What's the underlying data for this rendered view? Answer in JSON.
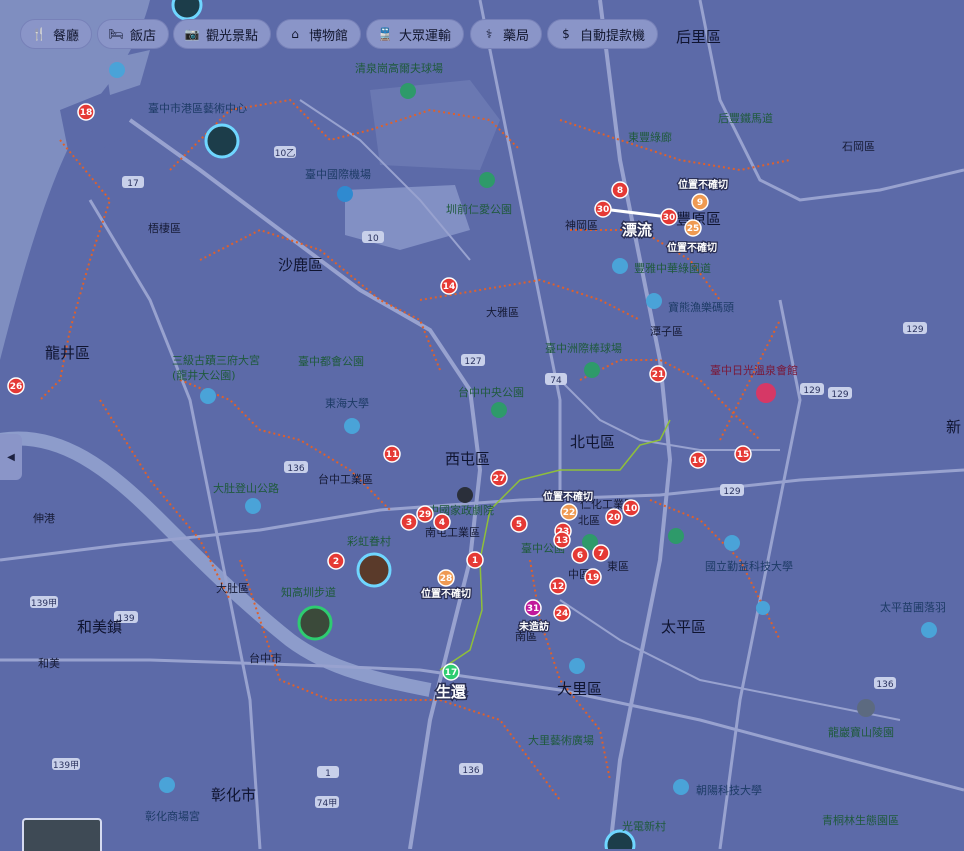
{
  "filters": [
    {
      "label": "餐廳",
      "icon": "restaurant-icon",
      "glyph": "🍴"
    },
    {
      "label": "飯店",
      "icon": "hotel-icon",
      "glyph": "🛏"
    },
    {
      "label": "觀光景點",
      "icon": "camera-icon",
      "glyph": "📷"
    },
    {
      "label": "博物館",
      "icon": "museum-icon",
      "glyph": "⌂"
    },
    {
      "label": "大眾運輸",
      "icon": "transit-icon",
      "glyph": "🚆"
    },
    {
      "label": "藥局",
      "icon": "pharmacy-icon",
      "glyph": "⚕"
    },
    {
      "label": "自動提款機",
      "icon": "atm-icon",
      "glyph": "$"
    }
  ],
  "districts": [
    {
      "name": "后里區"
    },
    {
      "name": "沙鹿區"
    },
    {
      "name": "龍井區"
    },
    {
      "name": "西屯區"
    },
    {
      "name": "北屯區"
    },
    {
      "name": "太平區"
    },
    {
      "name": "大里區"
    },
    {
      "name": "和美鎮"
    },
    {
      "name": "彰化市"
    },
    {
      "name": "豐原區"
    },
    {
      "name": "大雅區"
    },
    {
      "name": "神岡區"
    },
    {
      "name": "潭子區"
    },
    {
      "name": "梧棲區"
    },
    {
      "name": "大肚區"
    },
    {
      "name": "石岡區"
    },
    {
      "name": "北區"
    },
    {
      "name": "東區"
    },
    {
      "name": "南區"
    },
    {
      "name": "中區"
    },
    {
      "name": "伸港"
    },
    {
      "name": "和美"
    },
    {
      "name": "台中市"
    },
    {
      "name": "新"
    }
  ],
  "places": [
    {
      "name": "臺中市港區藝術中心",
      "kind": "poi-blue"
    },
    {
      "name": "清泉崗高爾夫球場",
      "kind": "poi"
    },
    {
      "name": "臺中國際機場",
      "kind": "poi-blue"
    },
    {
      "name": "圳前仁愛公園",
      "kind": "poi"
    },
    {
      "name": "三級古蹟三府大宮",
      "kind": "poi"
    },
    {
      "name": "(龍井大公園)",
      "kind": "poi"
    },
    {
      "name": "臺中都會公園",
      "kind": "poi"
    },
    {
      "name": "東海大學",
      "kind": "poi-blue"
    },
    {
      "name": "台中中央公園",
      "kind": "poi"
    },
    {
      "name": "臺中洲際棒球場",
      "kind": "poi"
    },
    {
      "name": "后豐鐵馬道",
      "kind": "poi"
    },
    {
      "name": "東豐綠廊",
      "kind": "poi"
    },
    {
      "name": "豐雅中華綠園道",
      "kind": "poi"
    },
    {
      "name": "寶熊漁樂碼頭",
      "kind": "poi-blue"
    },
    {
      "name": "臺中日光溫泉會館",
      "kind": "poi-pink"
    },
    {
      "name": "大肚登山公路",
      "kind": "poi"
    },
    {
      "name": "中國家政劇院",
      "kind": "poi"
    },
    {
      "name": "彩虹眷村",
      "kind": "poi"
    },
    {
      "name": "臺中公園",
      "kind": "poi"
    },
    {
      "name": "知高圳步道",
      "kind": "poi"
    },
    {
      "name": "大里藝術廣場",
      "kind": "poi"
    },
    {
      "name": "國立勤益科技大學",
      "kind": "poi-blue"
    },
    {
      "name": "朝陽科技大學",
      "kind": "poi-blue"
    },
    {
      "name": "太平苗圃落羽",
      "kind": "poi-blue"
    },
    {
      "name": "龍巖寶山陵園",
      "kind": "poi"
    },
    {
      "name": "青桐林生態園區",
      "kind": "poi"
    },
    {
      "name": "彰化商場宮",
      "kind": "poi-blue"
    },
    {
      "name": "光電新村",
      "kind": "poi"
    },
    {
      "name": "台中工業區",
      "kind": "lbl"
    },
    {
      "name": "南屯工業區",
      "kind": "lbl"
    },
    {
      "name": "仁化工業區",
      "kind": "lbl"
    }
  ],
  "markers": [
    {
      "n": "18",
      "c": "red"
    },
    {
      "n": "14",
      "c": "red"
    },
    {
      "n": "8",
      "c": "red"
    },
    {
      "n": "30",
      "c": "red"
    },
    {
      "n": "30",
      "c": "red"
    },
    {
      "n": "9",
      "c": "orange"
    },
    {
      "n": "25",
      "c": "orange"
    },
    {
      "n": "21",
      "c": "red"
    },
    {
      "n": "26",
      "c": "red"
    },
    {
      "n": "11",
      "c": "red"
    },
    {
      "n": "16",
      "c": "red"
    },
    {
      "n": "15",
      "c": "red"
    },
    {
      "n": "27",
      "c": "red"
    },
    {
      "n": "22",
      "c": "orange"
    },
    {
      "n": "10",
      "c": "red"
    },
    {
      "n": "20",
      "c": "red"
    },
    {
      "n": "29",
      "c": "red"
    },
    {
      "n": "3",
      "c": "red"
    },
    {
      "n": "4",
      "c": "red"
    },
    {
      "n": "5",
      "c": "red"
    },
    {
      "n": "23",
      "c": "red"
    },
    {
      "n": "13",
      "c": "red"
    },
    {
      "n": "6",
      "c": "red"
    },
    {
      "n": "7",
      "c": "red"
    },
    {
      "n": "2",
      "c": "red"
    },
    {
      "n": "1",
      "c": "red"
    },
    {
      "n": "28",
      "c": "orange"
    },
    {
      "n": "12",
      "c": "red"
    },
    {
      "n": "19",
      "c": "red"
    },
    {
      "n": "31",
      "c": "purple"
    },
    {
      "n": "24",
      "c": "red"
    },
    {
      "n": "17",
      "c": "green"
    }
  ],
  "notes": {
    "uncertain": "位置不確切",
    "drift": "漂流",
    "never_been": "未造訪",
    "born": "生還"
  },
  "colors": {
    "land": "#5c6aa8",
    "sea": "#7f8ec0",
    "road": "#98a2cf",
    "border": "#e0602a",
    "red": "#e53935",
    "orange": "#ef9a52",
    "green": "#2ecc71",
    "purple": "#c2189b"
  }
}
